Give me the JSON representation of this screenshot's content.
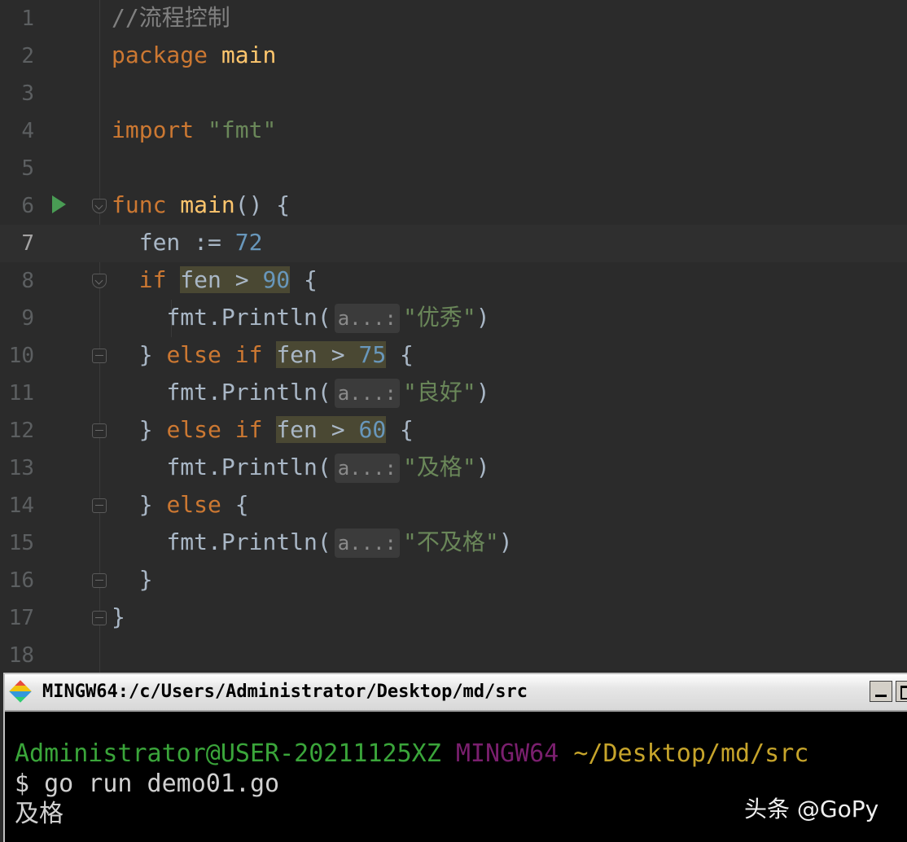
{
  "editor": {
    "line_numbers": [
      "1",
      "2",
      "3",
      "4",
      "5",
      "6",
      "7",
      "8",
      "9",
      "10",
      "11",
      "12",
      "13",
      "14",
      "15",
      "16",
      "17",
      "18"
    ],
    "lines": {
      "l1": {
        "comment": "//流程控制"
      },
      "l2": {
        "kw": "package",
        "name": "main"
      },
      "l4": {
        "kw": "import",
        "str": "\"fmt\""
      },
      "l6": {
        "kw": "func",
        "fn": "main",
        "rest": "() {"
      },
      "l7": {
        "var": "fen",
        "op": " := ",
        "num": "72"
      },
      "l8": {
        "kw": "if",
        "cond_var": "fen",
        "cond_op": " > ",
        "num": "90",
        "rest": " {"
      },
      "l9": {
        "pkg": "fmt",
        "call": ".Println(",
        "hint": "a...:",
        "str": "\"优秀\"",
        "close": ")"
      },
      "l10": {
        "brace": "} ",
        "kw": "else if",
        "cond_var": "fen",
        "cond_op": " > ",
        "num": "75",
        "rest": " {"
      },
      "l11": {
        "pkg": "fmt",
        "call": ".Println(",
        "hint": "a...:",
        "str": "\"良好\"",
        "close": ")"
      },
      "l12": {
        "brace": "} ",
        "kw": "else if",
        "cond_var": "fen",
        "cond_op": " > ",
        "num": "60",
        "rest": " {"
      },
      "l13": {
        "pkg": "fmt",
        "call": ".Println(",
        "hint": "a...:",
        "str": "\"及格\"",
        "close": ")"
      },
      "l14": {
        "brace": "} ",
        "kw": "else",
        "rest": " {"
      },
      "l15": {
        "pkg": "fmt",
        "call": ".Println(",
        "hint": "a...:",
        "str": "\"不及格\"",
        "close": ")"
      },
      "l16": {
        "brace": "}"
      },
      "l17": {
        "brace": "}"
      }
    },
    "current_line": 7
  },
  "terminal": {
    "title": "MINGW64:/c/Users/Administrator/Desktop/md/src",
    "prompt_user": "Administrator@USER-20211125XZ",
    "prompt_host": "MINGW64",
    "prompt_path": "~/Desktop/md/src",
    "command": "$ go run demo01.go",
    "output": "及格"
  },
  "watermark": "头条 @GoPy",
  "colors": {
    "editor_bg": "#2b2b2b",
    "keyword": "#cc7832",
    "function": "#ffc66d",
    "string": "#6a8759",
    "number": "#6897bb",
    "terminal_bg": "#000000",
    "prompt_user": "#3aa53a",
    "prompt_path": "#c6a42b"
  }
}
